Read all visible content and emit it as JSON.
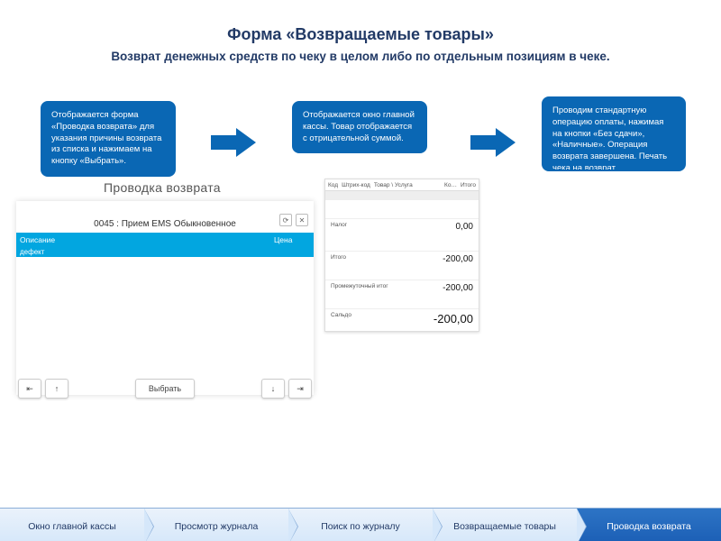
{
  "title": "Форма «Возвращаемые товары»",
  "subtitle": "Возврат денежных средств по чеку в целом либо по отдельным позициям в чеке.",
  "steps": [
    {
      "text": "Отображается форма «Проводка возврата» для указания причины возврата из списка и нажимаем на кнопку «Выбрать»."
    },
    {
      "text": "Отображается окно главной кассы.\nТовар отображается с отрицательной суммой."
    },
    {
      "text": "Проводим стандартную операцию оплаты, нажимая на кнопки «Без сдачи», «Наличные». Операция возврата завершена.\nПечать чека на возврат"
    }
  ],
  "leftPanel": {
    "title": "Проводка возврата",
    "item": "0045 : Прием EMS Обыкновенное",
    "columns": [
      "Описание",
      "Цена"
    ],
    "row": [
      "дефект"
    ],
    "selectLabel": "Выбрать"
  },
  "rightPanel": {
    "headers": [
      "Код",
      "Штрих-код",
      "Товар \\ Услуга",
      "Ко…",
      "Итого"
    ],
    "lines": [
      {
        "label": "Налог",
        "value": "0,00"
      },
      {
        "label": "Итого",
        "value": "-200,00"
      },
      {
        "label": "Промежуточный итог",
        "value": "-200,00"
      },
      {
        "label": "Сальдо",
        "value": "-200,00"
      }
    ]
  },
  "nav": [
    "Окно главной кассы",
    "Просмотр журнала",
    "Поиск по журналу",
    "Возвращаемые товары",
    "Проводка возврата"
  ]
}
